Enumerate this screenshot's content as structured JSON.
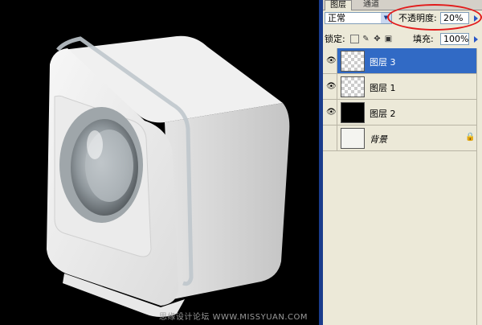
{
  "canvas": {
    "watermark": "思缘设计论坛 WWW.MISSYUAN.COM"
  },
  "panel": {
    "tabs": [
      {
        "label": "图层"
      },
      {
        "label": "通道"
      }
    ],
    "blend_mode": "正常",
    "opacity_label": "不透明度:",
    "opacity_value": "20%",
    "lock_label": "锁定:",
    "fill_label": "填充:",
    "fill_value": "100%",
    "layers": [
      {
        "name": "图层 3",
        "visible": true,
        "selected": true
      },
      {
        "name": "图层 1",
        "visible": true,
        "selected": false
      },
      {
        "name": "图层 2",
        "visible": true,
        "selected": false
      },
      {
        "name": "背景",
        "visible": false,
        "selected": false,
        "locked": true
      }
    ]
  },
  "colors": {
    "selection": "#316ac5",
    "panel_bg": "#ece9d8",
    "highlight_circle": "#e21b1b"
  }
}
